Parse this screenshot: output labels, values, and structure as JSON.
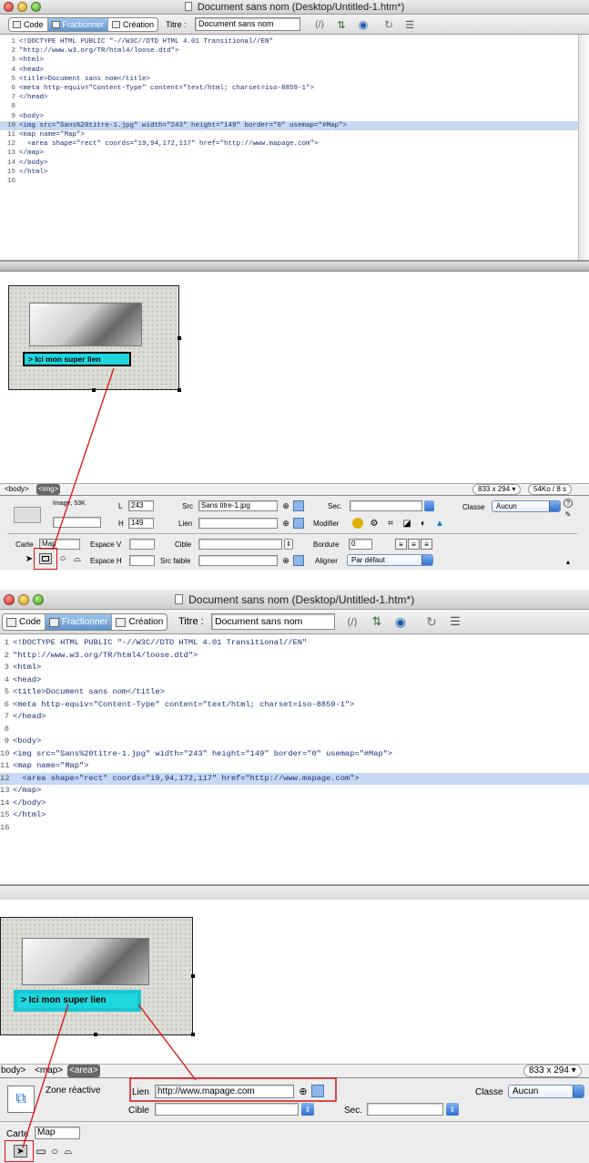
{
  "panel1": {
    "window_title": "Document sans nom (Desktop/Untitled-1.htm*)",
    "tabs": [
      {
        "label": "Code"
      },
      {
        "label": "Fractionner"
      },
      {
        "label": "Création"
      }
    ],
    "title_label": "Titre :",
    "title_value": "Document sans nom",
    "code_lines": [
      {
        "n": "1",
        "text": "<!DOCTYPE HTML PUBLIC \"-//W3C//DTD HTML 4.01 Transitional//EN\""
      },
      {
        "n": "2",
        "text": "\"http://www.w3.org/TR/html4/loose.dtd\">"
      },
      {
        "n": "3",
        "text": "<html>"
      },
      {
        "n": "4",
        "text": "<head>"
      },
      {
        "n": "5",
        "text": "<title>Document sans nom</title>"
      },
      {
        "n": "6",
        "text": "<meta http-equiv=\"Content-Type\" content=\"text/html; charset=iso-8859-1\">"
      },
      {
        "n": "7",
        "text": "</head>"
      },
      {
        "n": "8",
        "text": ""
      },
      {
        "n": "9",
        "text": "<body>"
      },
      {
        "n": "10",
        "text": "<img src=\"Sans%20titre-1.jpg\" width=\"243\" height=\"149\" border=\"0\" usemap=\"#Map\">"
      },
      {
        "n": "11",
        "text": "<map name=\"Map\">"
      },
      {
        "n": "12",
        "text": "  <area shape=\"rect\" coords=\"19,94,172,117\" href=\"http://www.mapage.com\">"
      },
      {
        "n": "13",
        "text": "</map>"
      },
      {
        "n": "14",
        "text": "</body>"
      },
      {
        "n": "15",
        "text": "</html>"
      },
      {
        "n": "16",
        "text": ""
      }
    ],
    "highlighted_line": "10",
    "link_text": "> Ici mon super lien",
    "tag_body": "<body>",
    "tag_img": "<img>",
    "window_size": "833 x 294",
    "file_info": "54Ko / 8 s",
    "props": {
      "image_label": "Image, 53K",
      "l_label": "L",
      "l_value": "243",
      "h_label": "H",
      "h_value": "149",
      "src_label": "Src",
      "src_value": "Sans titre-1.jpg",
      "lien_label": "Lien",
      "lien_value": "",
      "sec_label": "Sec.",
      "modifier_label": "Modifier",
      "classe_label": "Classe",
      "classe_value": "Aucun",
      "carte_label": "Carte",
      "carte_value": "Map",
      "espace_v_label": "Espace V",
      "espace_h_label": "Espace H",
      "cible_label": "Cible",
      "src_faible_label": "Src faible",
      "bordure_label": "Bordure",
      "bordure_value": "0",
      "aligner_label": "Aligner",
      "aligner_value": "Par défaut"
    }
  },
  "panel2": {
    "window_title": "Document sans nom (Desktop/Untitled-1.htm*)",
    "tabs": [
      {
        "label": "Code"
      },
      {
        "label": "Fractionner"
      },
      {
        "label": "Création"
      }
    ],
    "title_label": "Titre :",
    "title_value": "Document sans nom",
    "highlighted_line": "12",
    "link_text": "> Ici mon super lien",
    "tag_body": "body>",
    "tag_map": "<map>",
    "tag_area": "<area>",
    "window_size": "833 x 294",
    "props": {
      "zone_label": "Zone réactive",
      "lien_label": "Lien",
      "lien_value": "http://www.mapage.com",
      "cible_label": "Cible",
      "sec_label": "Sec.",
      "classe_label": "Classe",
      "classe_value": "Aucun",
      "carte_label": "Carte",
      "carte_value": "Map"
    }
  },
  "colors": {
    "link_button": "#1ed6de",
    "annotation_red": "#e01010",
    "selection_highlight": "#c7d9f2",
    "active_tab": "#5e94cf"
  }
}
